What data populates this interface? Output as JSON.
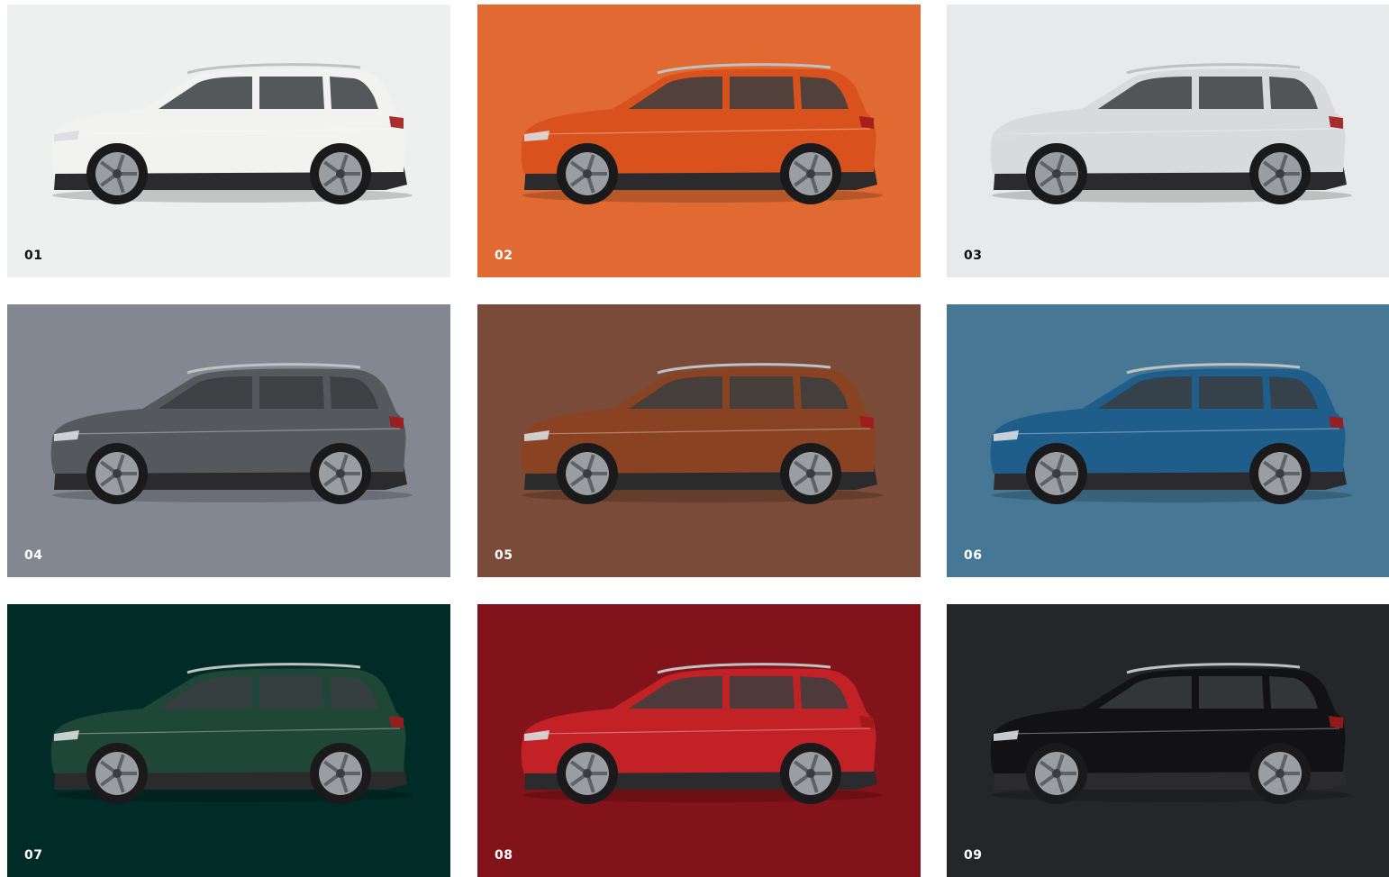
{
  "swatches": [
    {
      "label": "01",
      "background": "#eef0ef",
      "body": "#f2f2f0",
      "label_color": "#111111"
    },
    {
      "label": "02",
      "background": "#e06a32",
      "body": "#d9521e",
      "label_color": "#ffffff"
    },
    {
      "label": "03",
      "background": "#e8e9ea",
      "body": "#d9dadb",
      "label_color": "#111111"
    },
    {
      "label": "04",
      "background": "#838792",
      "body": "#55585d",
      "label_color": "#ffffff"
    },
    {
      "label": "05",
      "background": "#7a4b38",
      "body": "#8a4322",
      "label_color": "#ffffff"
    },
    {
      "label": "06",
      "background": "#467895",
      "body": "#1f5d8a",
      "label_color": "#ffffff"
    },
    {
      "label": "07",
      "background": "#002b27",
      "body": "#1e4737",
      "label_color": "#ffffff"
    },
    {
      "label": "08",
      "background": "#83131a",
      "body": "#c22226",
      "label_color": "#ffffff"
    },
    {
      "label": "09",
      "background": "#25262a",
      "body": "#121214",
      "label_color": "#ffffff"
    }
  ]
}
